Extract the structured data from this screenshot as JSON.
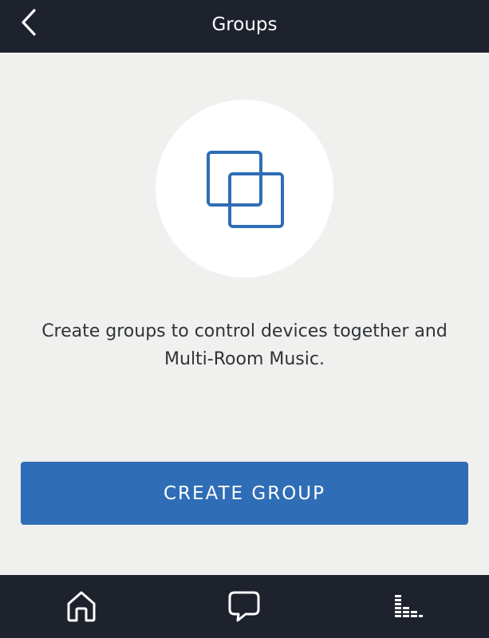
{
  "header": {
    "title": "Groups",
    "back_icon": "chevron-left-icon"
  },
  "illustration": {
    "icon": "overlapping-squares-icon",
    "accent_color": "#2f6db6"
  },
  "main": {
    "description": "Create groups to control devices together and Multi-Room Music.",
    "create_button_label": "CREATE GROUP"
  },
  "bottom_nav": {
    "items": [
      {
        "icon": "home-icon"
      },
      {
        "icon": "chat-bubble-icon"
      },
      {
        "icon": "music-bars-icon"
      }
    ]
  },
  "colors": {
    "bar_background": "#1d222d",
    "page_background": "#f0f0ef",
    "button": "#2f6db6"
  }
}
